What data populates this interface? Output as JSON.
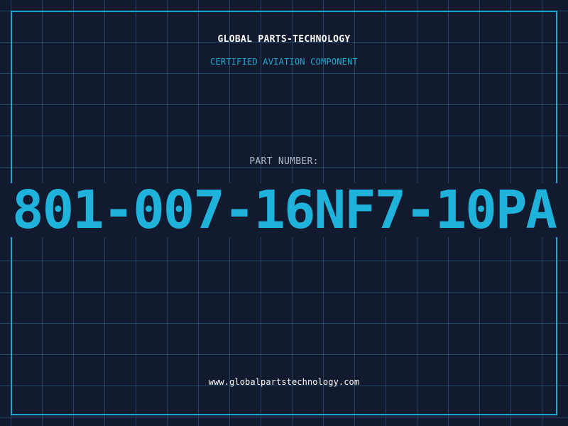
{
  "header": {
    "brand": "GLOBAL PARTS-TECHNOLOGY",
    "subtitle": "CERTIFIED AVIATION COMPONENT"
  },
  "part": {
    "label": "PART NUMBER:",
    "number": "801-007-16NF7-10PA"
  },
  "footer": {
    "url": "www.globalpartstechnology.com"
  },
  "colors": {
    "background": "#111a2e",
    "grid": "#286e8c",
    "accent": "#1aa8cf",
    "text": "#ffffff",
    "label": "#aeb8c8"
  }
}
